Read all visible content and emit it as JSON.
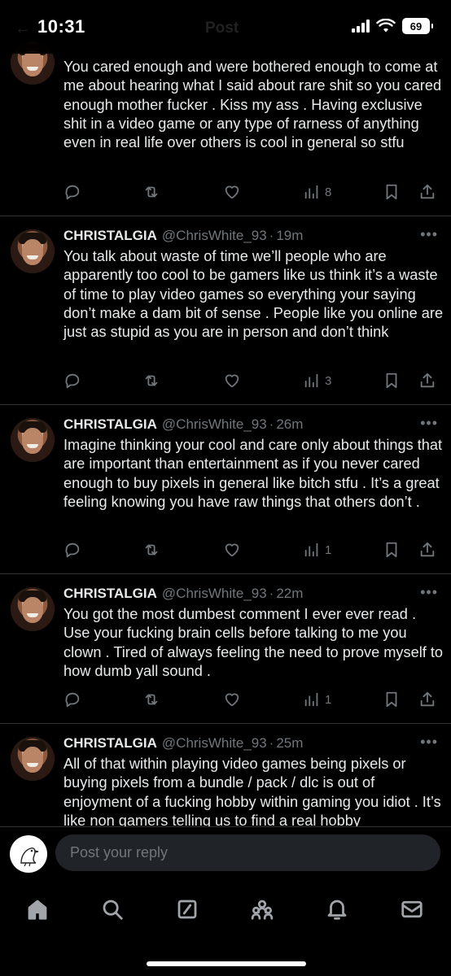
{
  "status_bar": {
    "time": "10:31",
    "battery": "69"
  },
  "header": {
    "title": "Post"
  },
  "posts": [
    {
      "author": "",
      "handle": "",
      "time": "",
      "text": "You cared enough and were bothered enough to come at me about hearing what I said about rare shit so you cared enough mother fucker . Kiss my ass . Having exclusive shit in a video game or any type of rarness of anything even in real life over others is cool in general so stfu",
      "views": "8"
    },
    {
      "author": "CHRISTALGIA",
      "handle": "@ChrisWhite_93",
      "time": "19m",
      "text": "You talk about waste of time we’ll people who are apparently too cool to be gamers like us think it’s a waste of time to play video games so everything your saying don’t make a dam bit of sense . People like you online are just as stupid as you are in person and don’t think",
      "views": "3"
    },
    {
      "author": "CHRISTALGIA",
      "handle": "@ChrisWhite_93",
      "time": "26m",
      "text": "Imagine thinking your cool and care only about things that are important than entertainment as if you never cared enough to buy pixels in general like bitch stfu . It’s a great feeling knowing you have raw things that others don’t .",
      "views": "1"
    },
    {
      "author": "CHRISTALGIA",
      "handle": "@ChrisWhite_93",
      "time": "22m",
      "text": "You got the most dumbest comment I ever ever read . Use your fucking brain cells before talking to me you clown . Tired of always feeling the need to prove myself to how dumb yall sound .",
      "views": "1"
    },
    {
      "author": "CHRISTALGIA",
      "handle": "@ChrisWhite_93",
      "time": "25m",
      "text": "All of that within playing video games being pixels or buying pixels from a bundle / pack / dlc is out of enjoyment of a fucking hobby within gaming you idiot . It’s like non gamers telling us to find a real hobby",
      "views": ""
    }
  ],
  "reply": {
    "placeholder": "Post your reply"
  },
  "nav": {
    "icons": [
      "home-icon",
      "search-icon",
      "grok-icon",
      "communities-icon",
      "notifications-icon",
      "messages-icon"
    ]
  },
  "colors": {
    "background": "#000000",
    "text": "#e7e9ea",
    "muted": "#71767b",
    "divider": "#2f3336",
    "input": "#202327"
  }
}
